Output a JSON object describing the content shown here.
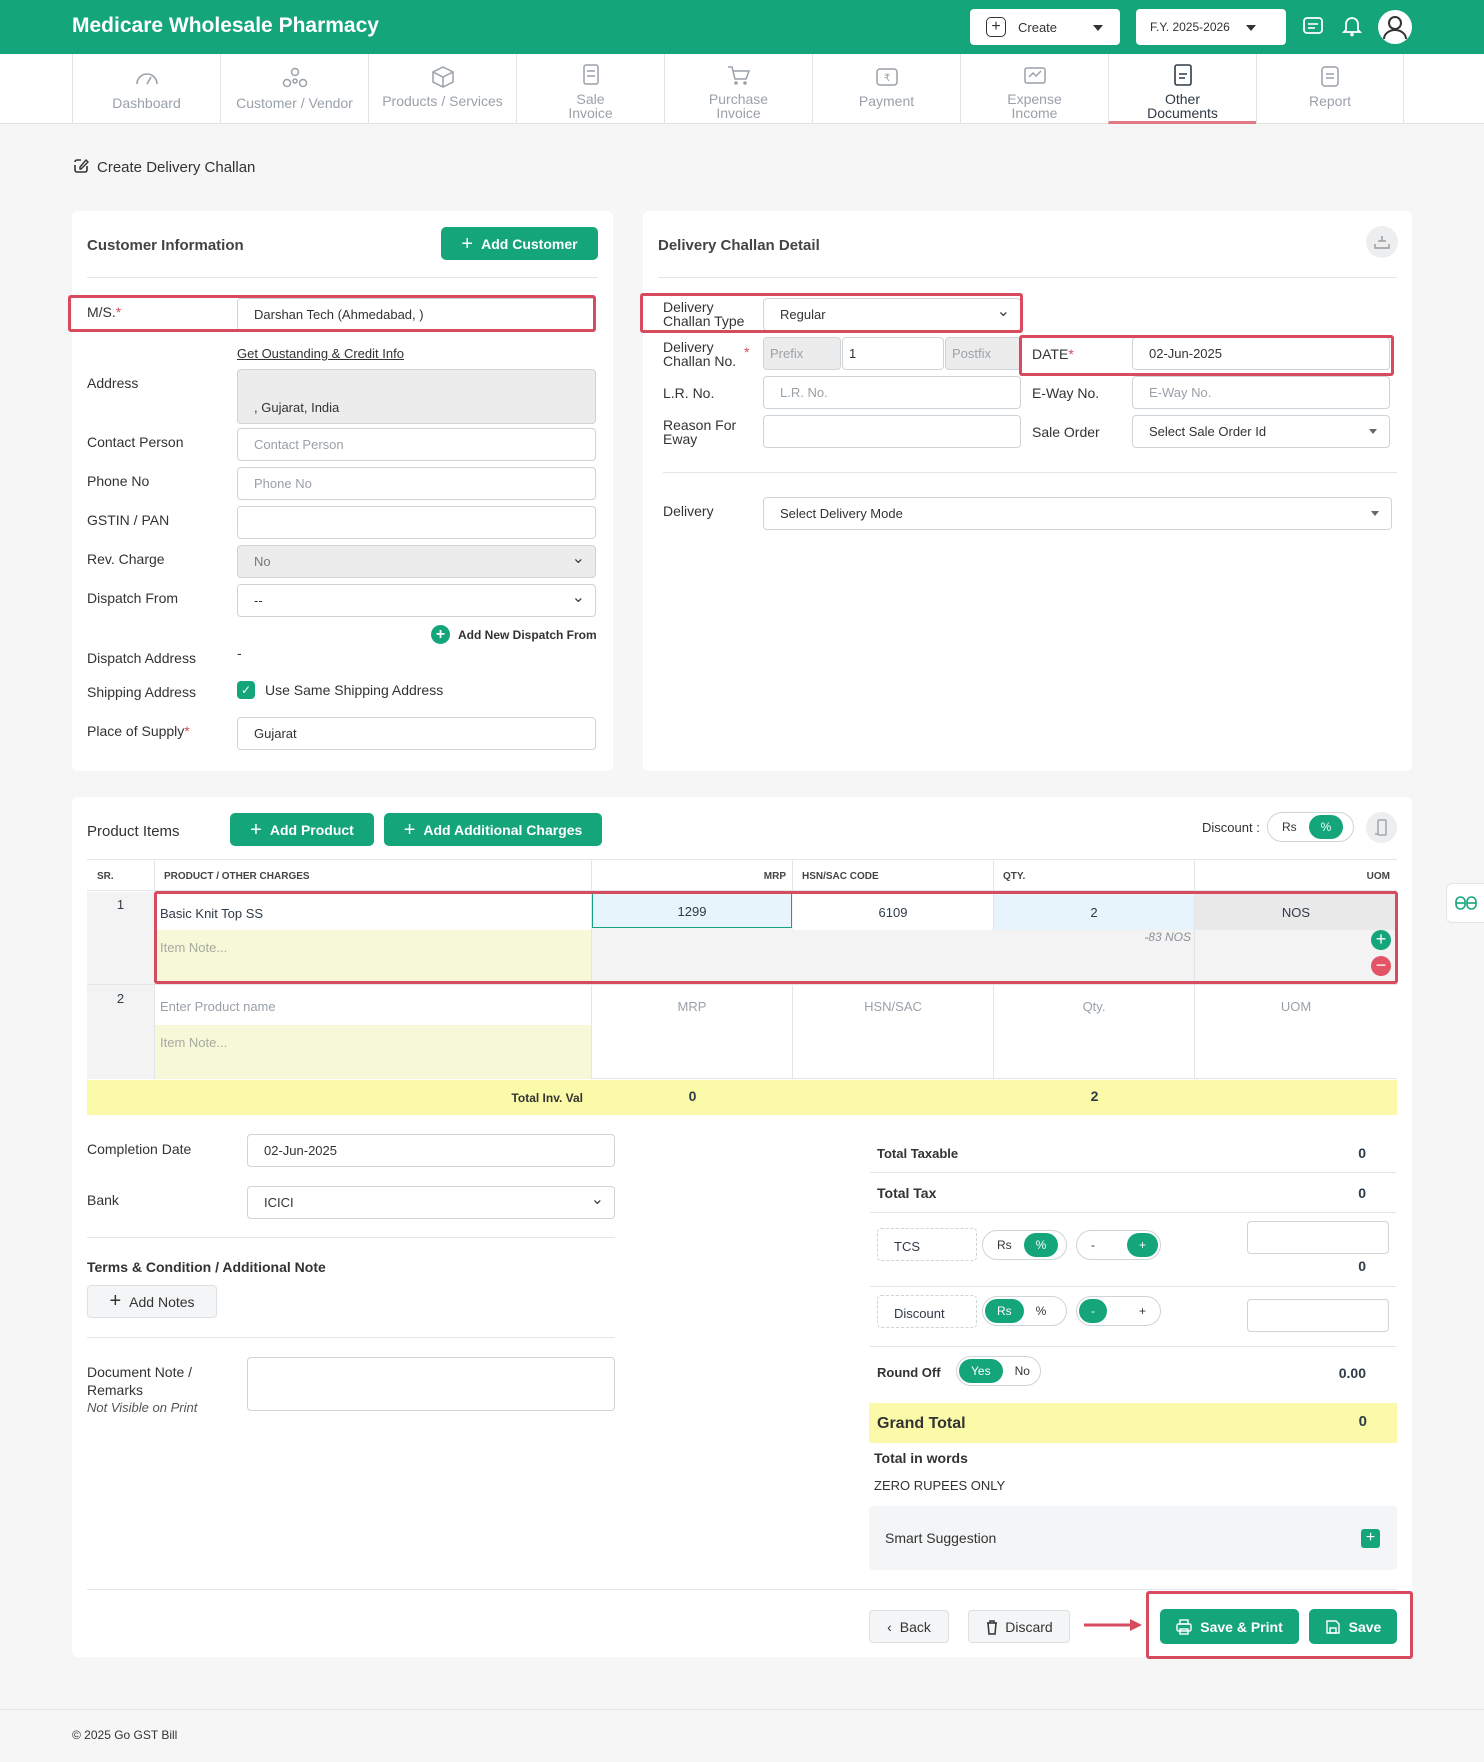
{
  "app": {
    "title": "Medicare Wholesale Pharmacy",
    "create_label": "Create",
    "fy_label": "F.Y. 2025-2026"
  },
  "nav": {
    "tabs": [
      {
        "l1": "Dashboard",
        "l2": ""
      },
      {
        "l1": "Customer / Vendor",
        "l2": ""
      },
      {
        "l1": "Products / Services",
        "l2": ""
      },
      {
        "l1": "Sale",
        "l2": "Invoice"
      },
      {
        "l1": "Purchase",
        "l2": "Invoice"
      },
      {
        "l1": "Payment",
        "l2": ""
      },
      {
        "l1": "Expense",
        "l2": "Income"
      },
      {
        "l1": "Other",
        "l2": "Documents"
      },
      {
        "l1": "Report",
        "l2": ""
      }
    ]
  },
  "page": {
    "title": "Create Delivery Challan"
  },
  "customer": {
    "section_title": "Customer Information",
    "add_customer": "Add Customer",
    "ms_label": "M/S.",
    "ms_value": "Darshan Tech (Ahmedabad, )",
    "credit_link": "Get Oustanding & Credit Info",
    "address_label": "Address",
    "address_value": ", Gujarat, India",
    "contact_label": "Contact Person",
    "contact_ph": "Contact Person",
    "phone_label": "Phone No",
    "phone_ph": "Phone No",
    "gstin_label": "GSTIN / PAN",
    "rev_label": "Rev. Charge",
    "rev_value": "No",
    "dispatch_label": "Dispatch From",
    "dispatch_value": "--",
    "add_dispatch": "Add New Dispatch From",
    "dispatch_addr_label": "Dispatch Address",
    "dispatch_addr_value": "-",
    "shipping_label": "Shipping Address",
    "shipping_check": "Use Same Shipping Address",
    "pos_label": "Place of Supply",
    "pos_value": "Gujarat"
  },
  "challan": {
    "section_title": "Delivery Challan Detail",
    "type_l1": "Delivery",
    "type_l2": "Challan Type",
    "type_value": "Regular",
    "no_l1": "Delivery",
    "no_l2": "Challan No.",
    "prefix_ph": "Prefix",
    "no_value": "1",
    "postfix_ph": "Postfix",
    "date_label": "DATE",
    "date_value": "02-Jun-2025",
    "lr_label": "L.R. No.",
    "lr_ph": "L.R. No.",
    "eway_label": "E-Way No.",
    "eway_ph": "E-Way No.",
    "reason_l1": "Reason For",
    "reason_l2": "Eway",
    "so_label": "Sale Order",
    "so_value": "Select Sale Order Id",
    "delivery_label": "Delivery",
    "delivery_value": "Select Delivery Mode"
  },
  "products": {
    "section_title": "Product Items",
    "add_product": "Add Product",
    "add_charges": "Add Additional Charges",
    "discount_label": "Discount :",
    "disc_rs": "Rs",
    "disc_pct": "%",
    "headers": [
      "SR.",
      "PRODUCT / OTHER CHARGES",
      "MRP",
      "HSN/SAC CODE",
      "QTY.",
      "UOM"
    ],
    "row1": {
      "sr": "1",
      "name": "Basic Knit Top SS",
      "note_ph": "Item Note...",
      "mrp": "1299",
      "hsn": "6109",
      "qty": "2",
      "uom": "NOS",
      "stock": "-83 NOS"
    },
    "row2": {
      "sr": "2",
      "name_ph": "Enter Product name",
      "note_ph": "Item Note...",
      "mrp_ph": "MRP",
      "hsn_ph": "HSN/SAC",
      "qty_ph": "Qty.",
      "uom_ph": "UOM"
    },
    "total_label": "Total Inv. Val",
    "total_mrp": "0",
    "total_qty": "2"
  },
  "extra": {
    "completion_label": "Completion Date",
    "completion_value": "02-Jun-2025",
    "bank_label": "Bank",
    "bank_value": "ICICI",
    "terms_title": "Terms & Condition / Additional Note",
    "add_notes": "Add Notes",
    "doc_note_l1": "Document Note /",
    "doc_note_l2": "Remarks",
    "doc_note_sub": "Not Visible on Print"
  },
  "summary": {
    "taxable_label": "Total Taxable",
    "taxable_value": "0",
    "tax_label": "Total Tax",
    "tax_value": "0",
    "tcs_label": "TCS",
    "tcs_value": "0",
    "rs": "Rs",
    "pct": "%",
    "minus": "-",
    "plus": "+",
    "discount_label": "Discount",
    "round_label": "Round Off",
    "yes": "Yes",
    "no": "No",
    "round_value": "0.00",
    "grand_label": "Grand Total",
    "grand_value": "0",
    "words_label": "Total in words",
    "words_value": "ZERO RUPEES ONLY",
    "smart_label": "Smart Suggestion"
  },
  "actions": {
    "back": "Back",
    "discard": "Discard",
    "save_print": "Save & Print",
    "save": "Save"
  },
  "footer": {
    "text": "© 2025 Go GST Bill"
  },
  "colors": {
    "primary": "#15a57b",
    "highlight_border": "#d64b5d",
    "total_row": "#fbfaa8",
    "note_bg": "#f6f8d8"
  }
}
